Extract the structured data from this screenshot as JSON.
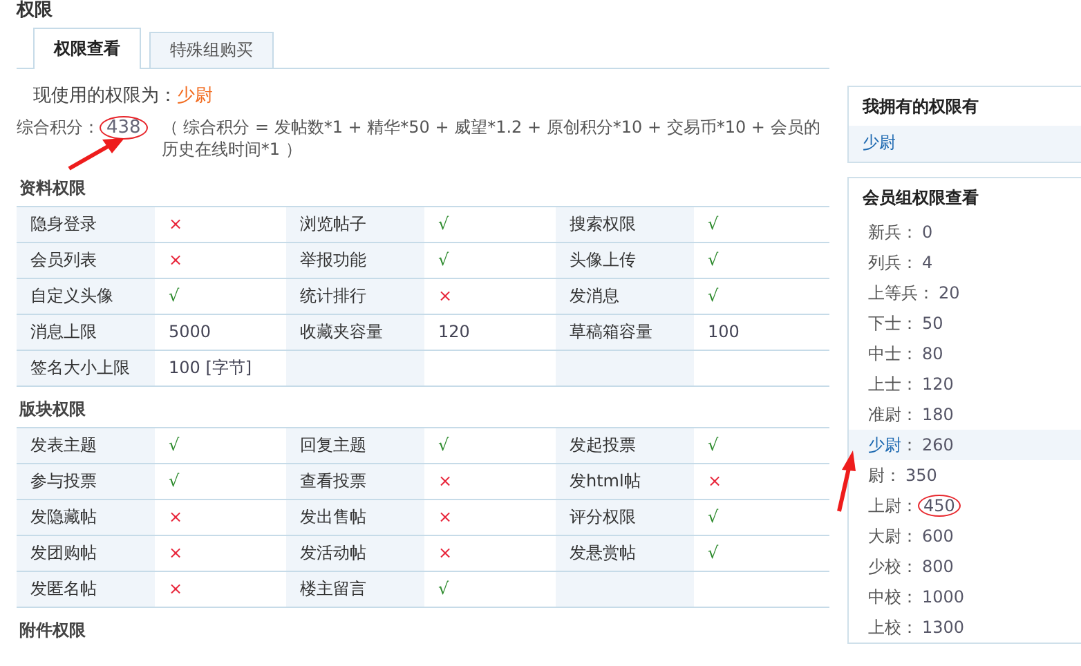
{
  "page_title": "权限",
  "tabs": [
    {
      "label": "权限查看",
      "selected": true
    },
    {
      "label": "特殊组购买",
      "selected": false
    }
  ],
  "current": {
    "label": "现使用的权限为：",
    "value": "少尉"
  },
  "score": {
    "label": "综合积分：",
    "value": "438",
    "circled": true,
    "arrow": true,
    "formula": "（ 综合积分 = 发帖数*1 + 精华*50 + 威望*1.2 + 原创积分*10 + 交易币*10 + 会员的历史在线时间*1 ）"
  },
  "sections": [
    {
      "title": "资料权限",
      "rows": [
        [
          {
            "label": "隐身登录",
            "value": "×",
            "kind": "no"
          },
          {
            "label": "浏览帖子",
            "value": "√",
            "kind": "yes"
          },
          {
            "label": "搜索权限",
            "value": "√",
            "kind": "yes"
          }
        ],
        [
          {
            "label": "会员列表",
            "value": "×",
            "kind": "no"
          },
          {
            "label": "举报功能",
            "value": "√",
            "kind": "yes"
          },
          {
            "label": "头像上传",
            "value": "√",
            "kind": "yes"
          }
        ],
        [
          {
            "label": "自定义头像",
            "value": "√",
            "kind": "yes"
          },
          {
            "label": "统计排行",
            "value": "×",
            "kind": "no"
          },
          {
            "label": "发消息",
            "value": "√",
            "kind": "yes"
          }
        ],
        [
          {
            "label": "消息上限",
            "value": "5000",
            "kind": "text"
          },
          {
            "label": "收藏夹容量",
            "value": "120",
            "kind": "text"
          },
          {
            "label": "草稿箱容量",
            "value": "100",
            "kind": "text"
          }
        ],
        [
          {
            "label": "签名大小上限",
            "value": "100 [字节]",
            "kind": "text"
          }
        ]
      ]
    },
    {
      "title": "版块权限",
      "rows": [
        [
          {
            "label": "发表主题",
            "value": "√",
            "kind": "yes"
          },
          {
            "label": "回复主题",
            "value": "√",
            "kind": "yes"
          },
          {
            "label": "发起投票",
            "value": "√",
            "kind": "yes"
          }
        ],
        [
          {
            "label": "参与投票",
            "value": "√",
            "kind": "yes"
          },
          {
            "label": "查看投票",
            "value": "×",
            "kind": "no"
          },
          {
            "label": "发html帖",
            "value": "×",
            "kind": "no"
          }
        ],
        [
          {
            "label": "发隐藏帖",
            "value": "×",
            "kind": "no"
          },
          {
            "label": "发出售帖",
            "value": "×",
            "kind": "no"
          },
          {
            "label": "评分权限",
            "value": "√",
            "kind": "yes"
          }
        ],
        [
          {
            "label": "发团购帖",
            "value": "×",
            "kind": "no"
          },
          {
            "label": "发活动帖",
            "value": "×",
            "kind": "no"
          },
          {
            "label": "发悬赏帖",
            "value": "√",
            "kind": "yes"
          }
        ],
        [
          {
            "label": "发匿名帖",
            "value": "×",
            "kind": "no"
          },
          {
            "label": "楼主留言",
            "value": "√",
            "kind": "yes"
          }
        ]
      ]
    },
    {
      "title": "附件权限"
    }
  ],
  "owned": {
    "title": "我拥有的权限有",
    "items": [
      "少尉"
    ]
  },
  "groups": {
    "title": "会员组权限查看",
    "separator": "：",
    "items": [
      {
        "rank": "新兵",
        "value": "0",
        "selected": false,
        "arrow": false,
        "circled": false
      },
      {
        "rank": "列兵",
        "value": "4",
        "selected": false,
        "arrow": false,
        "circled": false
      },
      {
        "rank": "上等兵",
        "value": "20",
        "selected": false,
        "arrow": false,
        "circled": false
      },
      {
        "rank": "下士",
        "value": "50",
        "selected": false,
        "arrow": false,
        "circled": false
      },
      {
        "rank": "中士",
        "value": "80",
        "selected": false,
        "arrow": false,
        "circled": false
      },
      {
        "rank": "上士",
        "value": "120",
        "selected": false,
        "arrow": false,
        "circled": false
      },
      {
        "rank": "准尉",
        "value": "180",
        "selected": false,
        "arrow": false,
        "circled": false
      },
      {
        "rank": "少尉",
        "value": "260",
        "selected": true,
        "arrow": true,
        "circled": false
      },
      {
        "rank": "尉",
        "value": "350",
        "selected": false,
        "arrow": false,
        "circled": false
      },
      {
        "rank": "上尉",
        "value": "450",
        "selected": false,
        "arrow": false,
        "circled": true
      },
      {
        "rank": "大尉",
        "value": "600",
        "selected": false,
        "arrow": false,
        "circled": false
      },
      {
        "rank": "少校",
        "value": "800",
        "selected": false,
        "arrow": false,
        "circled": false
      },
      {
        "rank": "中校",
        "value": "1000",
        "selected": false,
        "arrow": false,
        "circled": false
      },
      {
        "rank": "上校",
        "value": "1300",
        "selected": false,
        "arrow": false,
        "circled": false
      }
    ]
  }
}
